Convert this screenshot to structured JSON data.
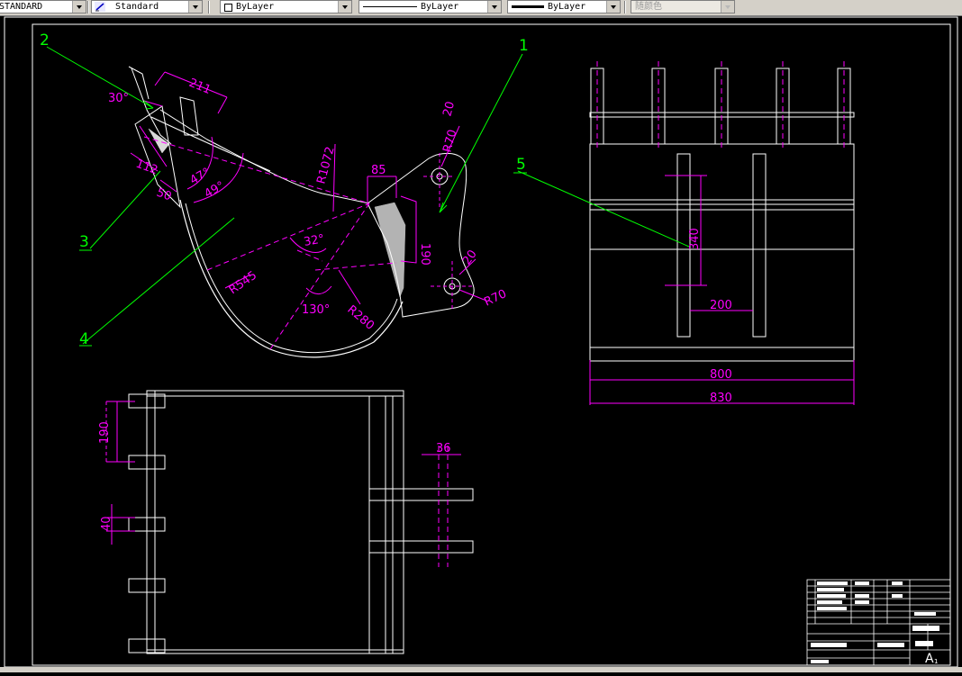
{
  "toolbar": {
    "text_style": "STANDARD",
    "dim_style": "Standard",
    "color": "ByLayer",
    "linetype": "ByLayer",
    "lineweight": "ByLayer",
    "plot_style": "随颜色"
  },
  "drawing": {
    "balloons": [
      "1",
      "2",
      "3",
      "4",
      "5"
    ],
    "side_view": {
      "dims": [
        "211",
        "30°",
        "112",
        "50",
        "47°",
        "49°",
        "R1072",
        "85",
        "190",
        "20",
        "R70",
        "32°",
        "R545",
        "130°",
        "R280",
        "20",
        "R70"
      ]
    },
    "front_view": {
      "dims": [
        "340",
        "200",
        "800",
        "830"
      ]
    },
    "top_view": {
      "dims": [
        "190",
        "40",
        "36"
      ]
    },
    "title_block": {
      "sheet_mark": "A",
      "sheet_sub": "1"
    }
  }
}
